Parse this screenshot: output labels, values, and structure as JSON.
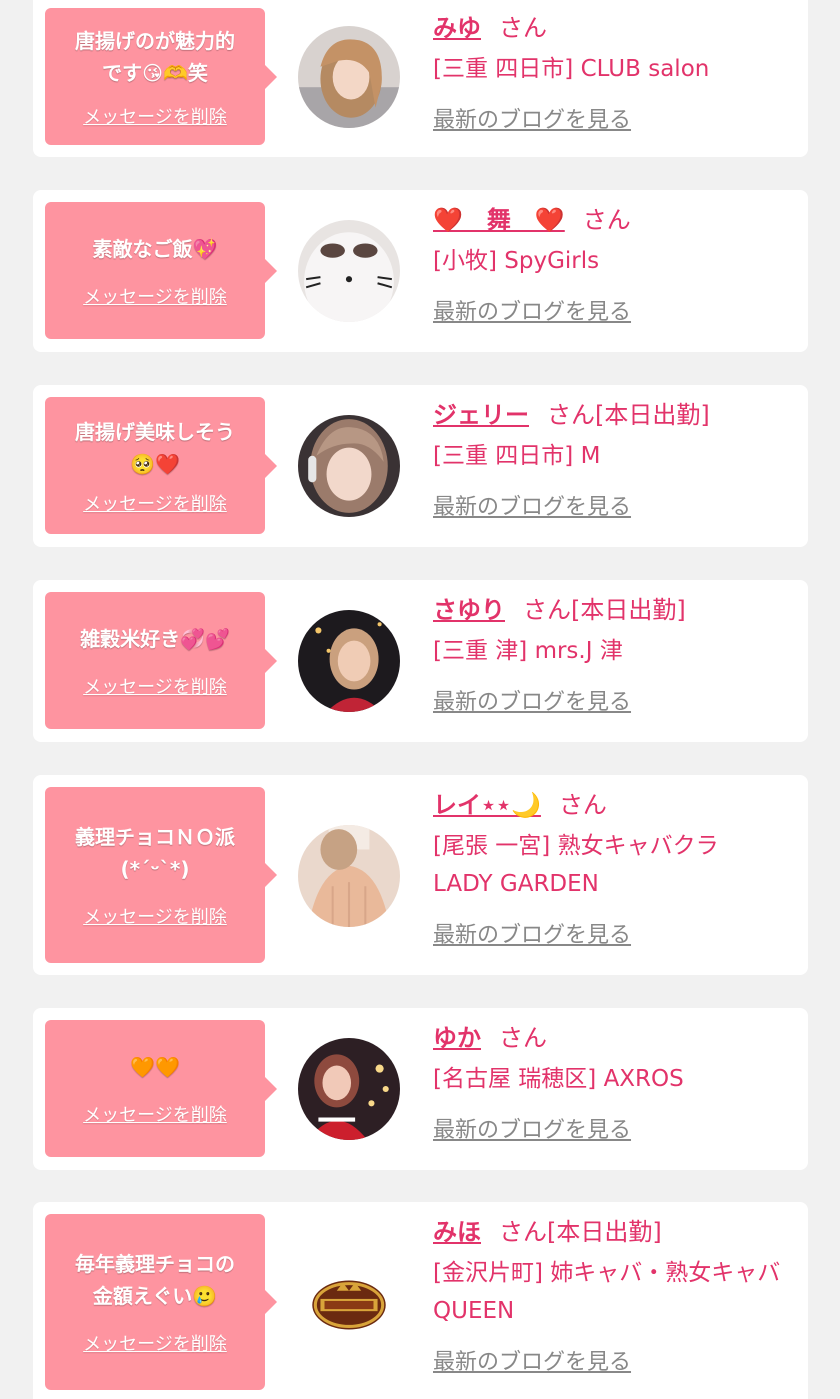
{
  "delete_label": "メッセージを削除",
  "blog_label": "最新のブログを見る",
  "san_label": "さん",
  "colors": {
    "accent": "#e2336a",
    "bubble": "#fe94a0",
    "background": "#f1f1f1",
    "link_gray": "#888888"
  },
  "entries": [
    {
      "message": "唐揚げのが魅力的\nです😘🫶笑",
      "name": "みゆ",
      "status": "",
      "shop": "[三重 四日市] CLUB salon",
      "avatar_icon": "avatar-photo-icon"
    },
    {
      "message": "素敵なご飯💖",
      "name": "❤️　舞　❤️",
      "status": "",
      "shop": "[小牧] SpyGirls",
      "avatar_icon": "avatar-photo-icon"
    },
    {
      "message": "唐揚げ美味しそう\n🥺❤️",
      "name": "ジェリー",
      "status": "[本日出勤]",
      "shop": "[三重 四日市] M",
      "avatar_icon": "avatar-photo-icon"
    },
    {
      "message": "雑穀米好き💞💕",
      "name": "さゆり",
      "status": "[本日出勤]",
      "shop": "[三重 津] mrs.J 津",
      "avatar_icon": "avatar-photo-icon"
    },
    {
      "message": "義理チョコＮＯ派\n(*ˊᵕˋ*)",
      "name": "レイ⋆⋆🌙",
      "status": "",
      "shop": "[尾張 一宮] 熟女キャバクラ LADY GARDEN",
      "avatar_icon": "avatar-photo-icon"
    },
    {
      "message": "🧡🧡",
      "name": "ゆか",
      "status": "",
      "shop": "[名古屋 瑞穂区] AXROS",
      "avatar_icon": "avatar-photo-icon"
    },
    {
      "message": "毎年義理チョコの\n金額えぐい🥲",
      "name": "みほ",
      "status": "[本日出勤]",
      "shop": "[金沢片町] 姉キャバ・熟女キャバ QUEEN",
      "avatar_icon": "queen-logo-icon"
    }
  ]
}
